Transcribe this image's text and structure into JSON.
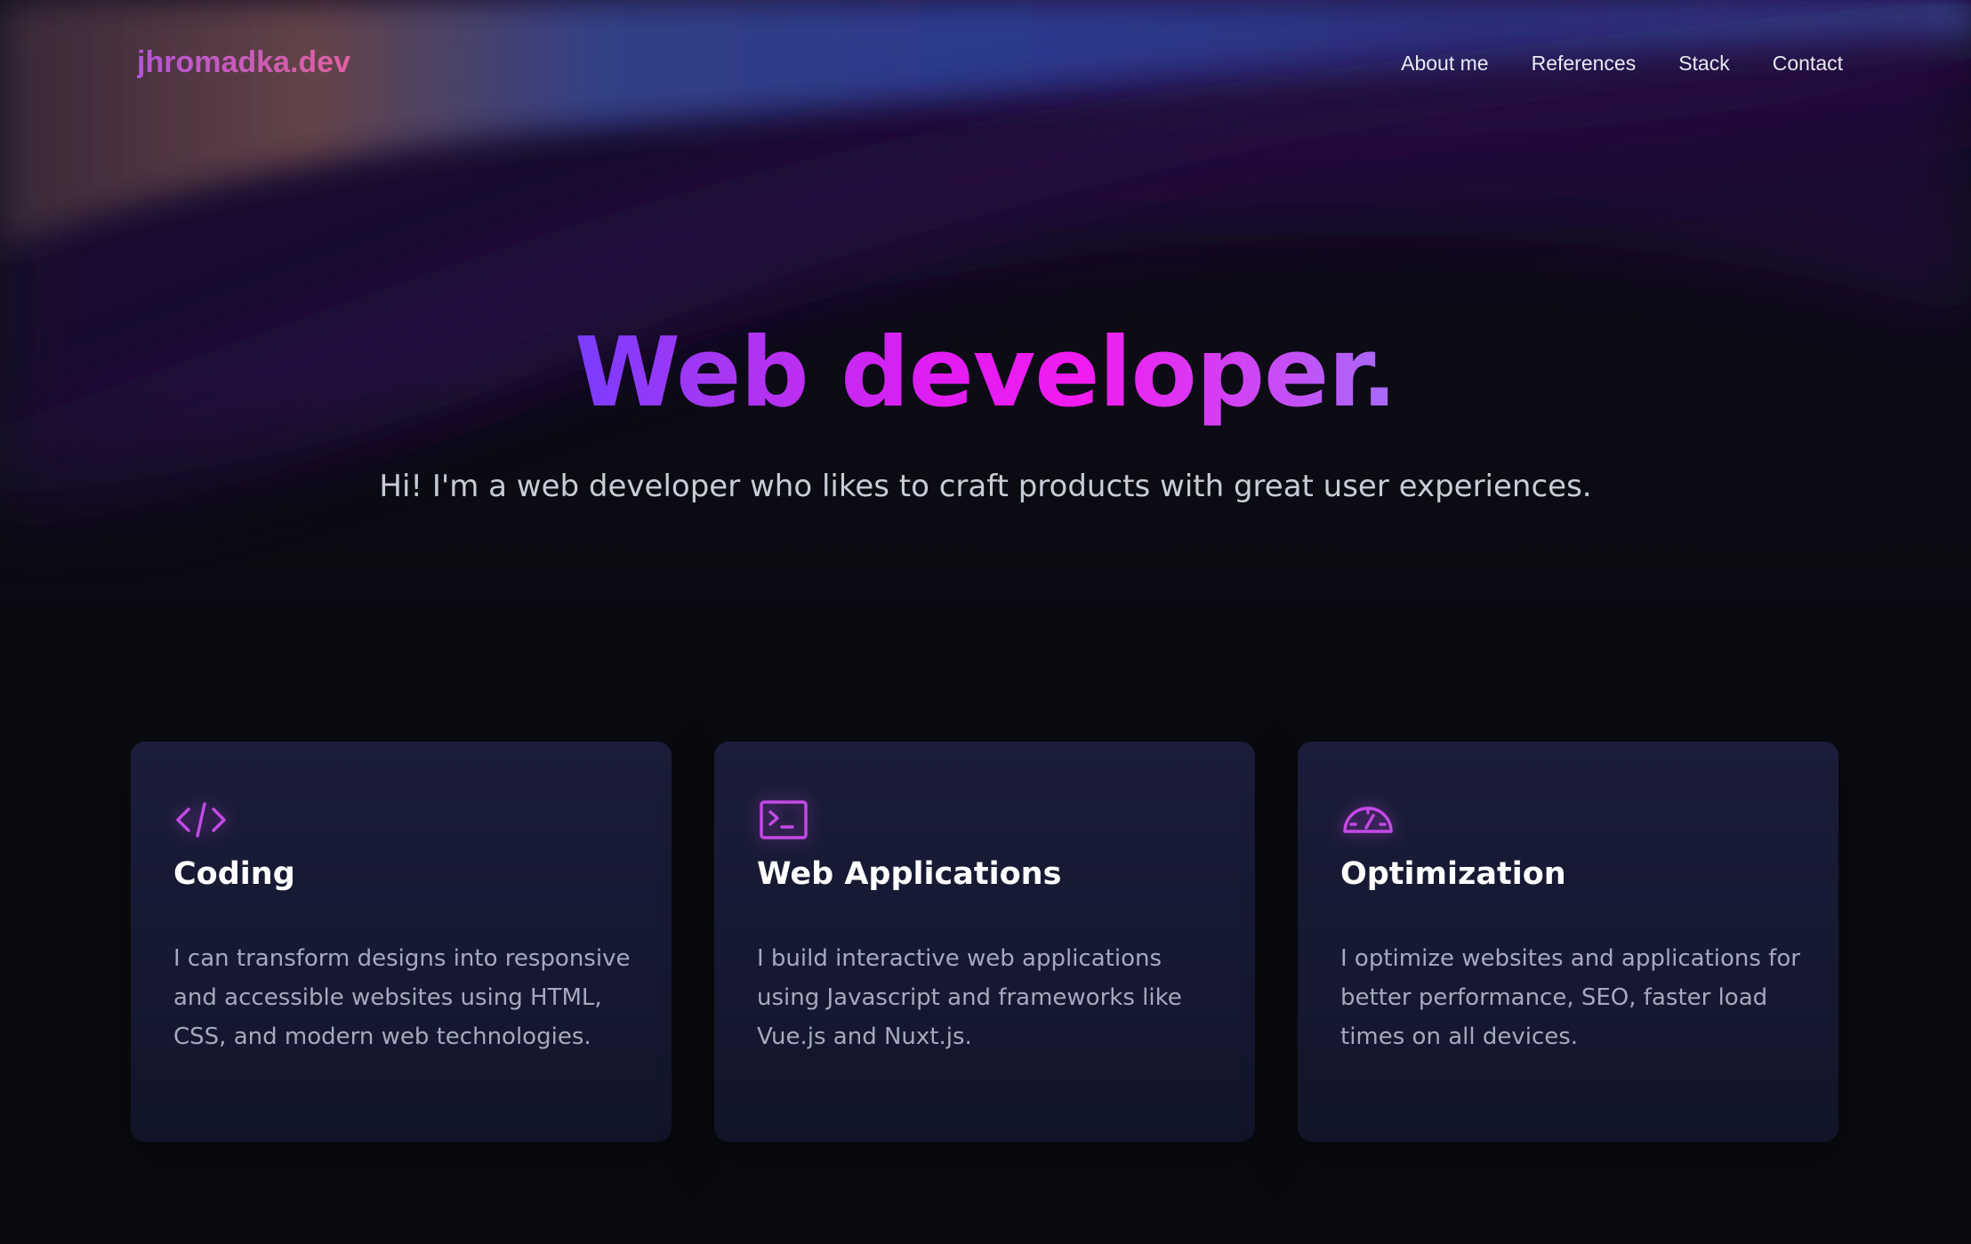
{
  "brand": {
    "name": "jhromadka.dev"
  },
  "nav": {
    "items": [
      {
        "label": "About me"
      },
      {
        "label": "References"
      },
      {
        "label": "Stack"
      },
      {
        "label": "Contact"
      }
    ]
  },
  "hero": {
    "title": "Web developer.",
    "subtitle": "Hi! I'm a web developer who likes to craft products with great user experiences."
  },
  "services": [
    {
      "icon": "code-icon",
      "title": "Coding",
      "text": "I can transform designs into responsive and accessible websites using HTML, CSS, and modern web technologies."
    },
    {
      "icon": "terminal-icon",
      "title": "Web Applications",
      "text": "I build interactive web applications using Javascript and frameworks like Vue.js and Nuxt.js."
    },
    {
      "icon": "gauge-icon",
      "title": "Optimization",
      "text": "I optimize websites and applications for better performance, SEO, faster load times on all devices."
    }
  ],
  "colors": {
    "background": "#0a0b10",
    "accent": "#e21cf3",
    "accent_violet": "#7a3cff",
    "icon": "#c44ae6",
    "card": "#181a35"
  }
}
